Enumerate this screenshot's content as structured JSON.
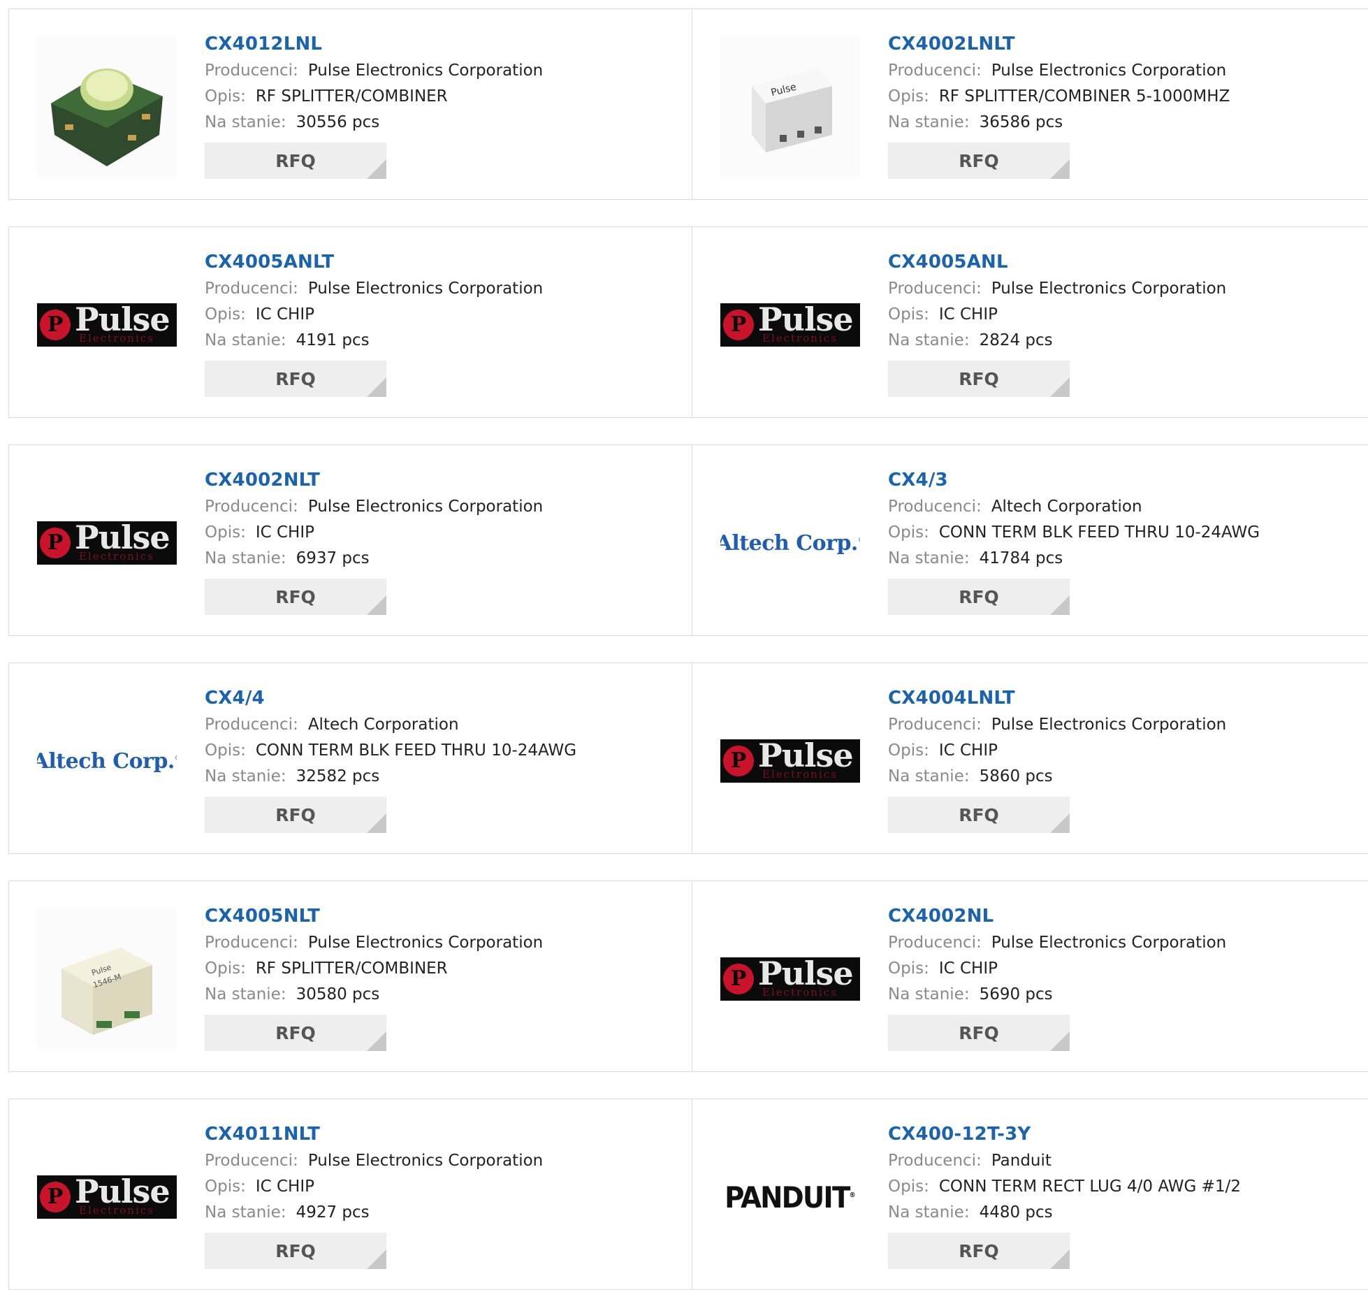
{
  "labels": {
    "manufacturer": "Producenci:",
    "description": "Opis:",
    "stock": "Na stanie:",
    "rfq": "RFQ"
  },
  "logos": {
    "pulse_word": "Pulse",
    "pulse_sub": "Electronics",
    "altech": "Altech Corp.",
    "panduit": "PANDUIT"
  },
  "products": [
    {
      "pn": "CX4012LNL",
      "manufacturer": "Pulse Electronics Corporation",
      "description": "RF SPLITTER/COMBINER",
      "stock": "30556 pcs",
      "image": "photo-green-component"
    },
    {
      "pn": "CX4002LNLT",
      "manufacturer": "Pulse Electronics Corporation",
      "description": "RF SPLITTER/COMBINER 5-1000MHZ",
      "stock": "36586 pcs",
      "image": "photo-white-component"
    },
    {
      "pn": "CX4005ANLT",
      "manufacturer": "Pulse Electronics Corporation",
      "description": "IC CHIP",
      "stock": "4191 pcs",
      "image": "pulse-logo"
    },
    {
      "pn": "CX4005ANL",
      "manufacturer": "Pulse Electronics Corporation",
      "description": "IC CHIP",
      "stock": "2824 pcs",
      "image": "pulse-logo"
    },
    {
      "pn": "CX4002NLT",
      "manufacturer": "Pulse Electronics Corporation",
      "description": "IC CHIP",
      "stock": "6937 pcs",
      "image": "pulse-logo"
    },
    {
      "pn": "CX4/3",
      "manufacturer": "Altech Corporation",
      "description": "CONN TERM BLK FEED THRU 10-24AWG",
      "stock": "41784 pcs",
      "image": "altech-logo"
    },
    {
      "pn": "CX4/4",
      "manufacturer": "Altech Corporation",
      "description": "CONN TERM BLK FEED THRU 10-24AWG",
      "stock": "32582 pcs",
      "image": "altech-logo"
    },
    {
      "pn": "CX4004LNLT",
      "manufacturer": "Pulse Electronics Corporation",
      "description": "IC CHIP",
      "stock": "5860 pcs",
      "image": "pulse-logo"
    },
    {
      "pn": "CX4005NLT",
      "manufacturer": "Pulse Electronics Corporation",
      "description": "RF SPLITTER/COMBINER",
      "stock": "30580 pcs",
      "image": "photo-cream-component"
    },
    {
      "pn": "CX4002NL",
      "manufacturer": "Pulse Electronics Corporation",
      "description": "IC CHIP",
      "stock": "5690 pcs",
      "image": "pulse-logo"
    },
    {
      "pn": "CX4011NLT",
      "manufacturer": "Pulse Electronics Corporation",
      "description": "IC CHIP",
      "stock": "4927 pcs",
      "image": "pulse-logo"
    },
    {
      "pn": "CX400-12T-3Y",
      "manufacturer": "Panduit",
      "description": "CONN TERM RECT LUG 4/0 AWG #1/2",
      "stock": "4480 pcs",
      "image": "panduit-logo"
    }
  ]
}
